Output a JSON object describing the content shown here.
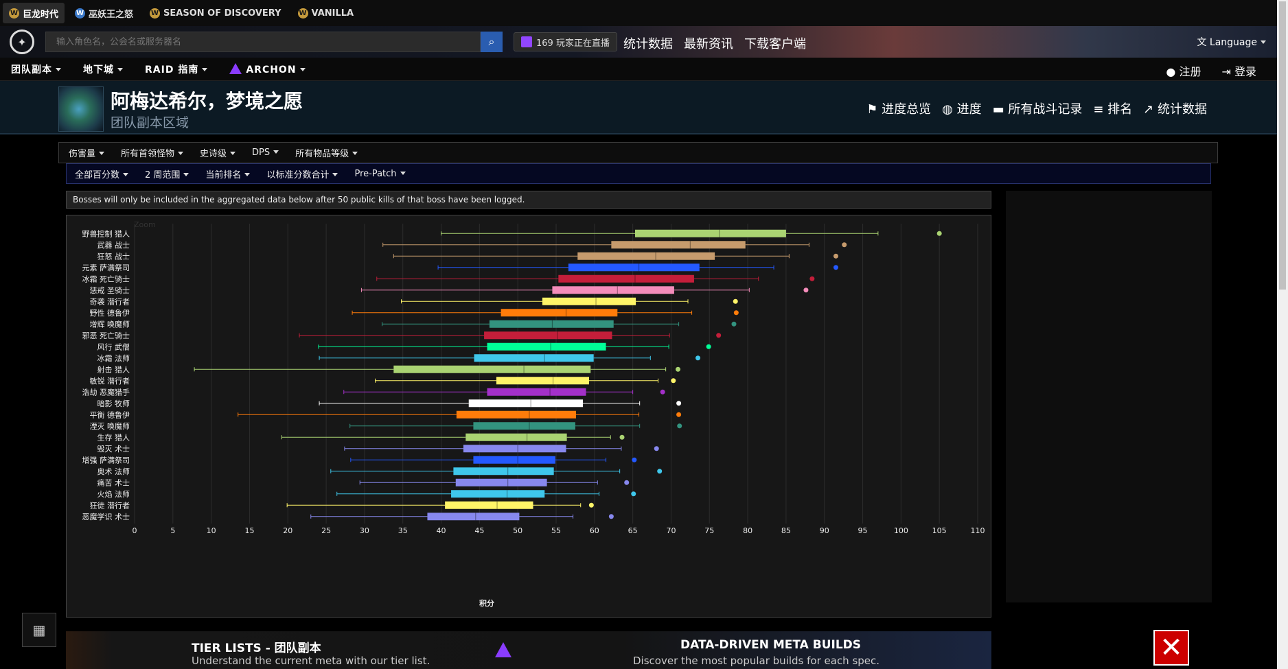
{
  "game_tabs": [
    {
      "icon": "W",
      "label": "巨龙时代",
      "active": true
    },
    {
      "icon": "W",
      "label": "巫妖王之怒",
      "active": false
    },
    {
      "icon": "W",
      "label": "SEASON OF DISCOVERY",
      "active": false
    },
    {
      "icon": "W",
      "label": "VANILLA",
      "active": false
    }
  ],
  "search": {
    "placeholder": "输入角色名，公会名或服务器名"
  },
  "live": {
    "label": "169 玩家正在直播"
  },
  "topnav": [
    "统计数据",
    "最新资讯",
    "下载客户端"
  ],
  "language": "Language",
  "mainnav": [
    "团队副本",
    "地下城",
    "RAID 指南",
    "ARCHON"
  ],
  "auth": {
    "register": "注册",
    "login": "登录"
  },
  "zone": {
    "title": "阿梅达希尔，梦境之愿",
    "subtitle": "团队副本区域"
  },
  "zonenav": [
    "进度总览",
    "进度",
    "所有战斗记录",
    "排名",
    "统计数据"
  ],
  "filters_row1": [
    "伤害量",
    "所有首领怪物",
    "史诗级",
    "DPS",
    "所有物品等级"
  ],
  "filters_row2": [
    "全部百分数",
    "2 周范围",
    "当前排名",
    "以标准分数合计",
    "Pre-Patch"
  ],
  "notice": "Bosses will only be included in the aggregated data below after 50 public kills of that boss have been logged.",
  "banner": {
    "tier_title": "TIER LISTS - 团队副本",
    "tier_sub": "Understand the current meta with our tier list.",
    "meta_title": "DATA-DRIVEN META BUILDS",
    "meta_sub": "Discover the most popular builds for each spec."
  },
  "chart_data": {
    "type": "boxplot",
    "zoom_label": "Zoom",
    "xlabel": "积分",
    "xlim": [
      0,
      110
    ],
    "xticks": [
      0,
      5,
      10,
      15,
      20,
      25,
      30,
      35,
      40,
      45,
      50,
      55,
      60,
      65,
      70,
      75,
      80,
      85,
      90,
      95,
      100,
      105,
      110
    ],
    "grid": true,
    "series": [
      {
        "name": "野兽控制 猎人",
        "min": 40,
        "q1": 65.3,
        "median": 76.3,
        "q3": 85,
        "max": 97,
        "outlier": 105,
        "color": "#aad372"
      },
      {
        "name": "武器 战士",
        "min": 32.4,
        "q1": 62.2,
        "median": 72.5,
        "q3": 79.7,
        "max": 88,
        "outlier": 92.6,
        "color": "#c69b6d"
      },
      {
        "name": "狂怒 战士",
        "min": 33.8,
        "q1": 57.8,
        "median": 68,
        "q3": 75.7,
        "max": 85.4,
        "outlier": 91.5,
        "color": "#c69b6d"
      },
      {
        "name": "元素 萨满祭司",
        "min": 39.6,
        "q1": 56.6,
        "median": 65.8,
        "q3": 73.7,
        "max": 83.4,
        "outlier": 91.5,
        "color": "#2459ff"
      },
      {
        "name": "冰霜 死亡骑士",
        "min": 31.6,
        "q1": 55.3,
        "median": 65.3,
        "q3": 73,
        "max": 81.4,
        "outlier": 88.4,
        "color": "#c41e3a"
      },
      {
        "name": "惩戒 圣骑士",
        "min": 29.6,
        "q1": 54.5,
        "median": 63,
        "q3": 70.4,
        "max": 80.2,
        "outlier": 87.6,
        "color": "#f48cba"
      },
      {
        "name": "奇袭 潜行者",
        "min": 34.8,
        "q1": 53.2,
        "median": 60.2,
        "q3": 65.4,
        "max": 72.2,
        "outlier": 78.4,
        "color": "#fff468"
      },
      {
        "name": "野性 德鲁伊",
        "min": 28.4,
        "q1": 47.8,
        "median": 56.3,
        "q3": 63,
        "max": 72.7,
        "outlier": 78.5,
        "color": "#ff7c0a"
      },
      {
        "name": "增辉 唤魔师",
        "min": 32.3,
        "q1": 46.3,
        "median": 54.5,
        "q3": 62.5,
        "max": 71,
        "outlier": 78.2,
        "color": "#33937f"
      },
      {
        "name": "邪恶 死亡骑士",
        "min": 21.5,
        "q1": 45.6,
        "median": 55.2,
        "q3": 62.3,
        "max": 69.8,
        "outlier": 76.2,
        "color": "#c41e3a"
      },
      {
        "name": "风行 武僧",
        "min": 24,
        "q1": 46,
        "median": 54.3,
        "q3": 61.5,
        "max": 69.7,
        "outlier": 74.9,
        "color": "#00ff98"
      },
      {
        "name": "冰霜 法师",
        "min": 24.1,
        "q1": 44.3,
        "median": 53.5,
        "q3": 59.9,
        "max": 67.3,
        "outlier": 73.5,
        "color": "#3fc7eb"
      },
      {
        "name": "射击 猎人",
        "min": 7.8,
        "q1": 33.8,
        "median": 50.8,
        "q3": 59.5,
        "max": 69.3,
        "outlier": 70.9,
        "color": "#aad372"
      },
      {
        "name": "敏锐 潜行者",
        "min": 31.4,
        "q1": 47.2,
        "median": 54.6,
        "q3": 59.3,
        "max": 68.3,
        "outlier": 70.3,
        "color": "#fff468"
      },
      {
        "name": "浩劫 恶魔猎手",
        "min": 27.3,
        "q1": 46,
        "median": 54.2,
        "q3": 58.9,
        "max": 65,
        "outlier": 68.9,
        "color": "#a330c9"
      },
      {
        "name": "暗影 牧师",
        "min": 24.1,
        "q1": 43.6,
        "median": 51.7,
        "q3": 58.5,
        "max": 65.9,
        "outlier": 71,
        "color": "#ffffff"
      },
      {
        "name": "平衡 德鲁伊",
        "min": 13.5,
        "q1": 42,
        "median": 51.5,
        "q3": 57.6,
        "max": 65.8,
        "outlier": 71,
        "color": "#ff7c0a"
      },
      {
        "name": "湮灭 唤魔师",
        "min": 28.1,
        "q1": 44.2,
        "median": 51.5,
        "q3": 57.5,
        "max": 65.9,
        "outlier": 71.1,
        "color": "#33937f"
      },
      {
        "name": "生存 猎人",
        "min": 19.2,
        "q1": 43.2,
        "median": 51.2,
        "q3": 56.4,
        "max": 62.1,
        "outlier": 63.6,
        "color": "#aad372"
      },
      {
        "name": "毁灭 术士",
        "min": 27.4,
        "q1": 42.9,
        "median": 50,
        "q3": 56.3,
        "max": 63.5,
        "outlier": 68.1,
        "color": "#8788ee"
      },
      {
        "name": "增强 萨满祭司",
        "min": 28.2,
        "q1": 44.2,
        "median": 50,
        "q3": 54.9,
        "max": 61.5,
        "outlier": 65.2,
        "color": "#2459ff"
      },
      {
        "name": "奥术 法师",
        "min": 25.6,
        "q1": 41.6,
        "median": 48.7,
        "q3": 54.7,
        "max": 63.3,
        "outlier": 68.5,
        "color": "#3fc7eb"
      },
      {
        "name": "痛苦 术士",
        "min": 29.4,
        "q1": 41.9,
        "median": 48.7,
        "q3": 53.8,
        "max": 60.4,
        "outlier": 64.2,
        "color": "#8788ee"
      },
      {
        "name": "火焰 法师",
        "min": 26.4,
        "q1": 41.3,
        "median": 48.6,
        "q3": 53.5,
        "max": 60.6,
        "outlier": 65.1,
        "color": "#3fc7eb"
      },
      {
        "name": "狂徒 潜行者",
        "min": 19.9,
        "q1": 40.5,
        "median": 47.3,
        "q3": 52,
        "max": 58.2,
        "outlier": 59.6,
        "color": "#fff468"
      },
      {
        "name": "恶魔学识 术士",
        "min": 23,
        "q1": 38.2,
        "median": 44.5,
        "q3": 50.2,
        "max": 57.2,
        "outlier": 62.2,
        "color": "#8788ee"
      }
    ]
  }
}
